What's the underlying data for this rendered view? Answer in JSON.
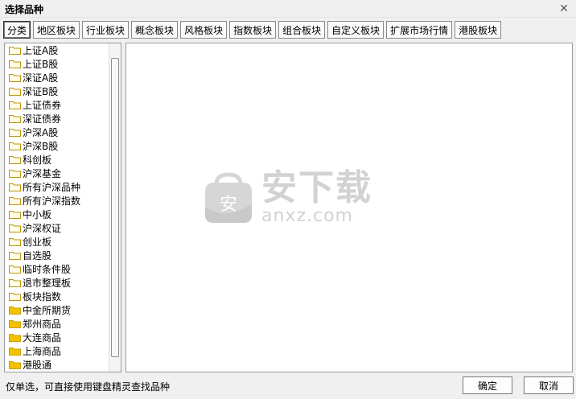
{
  "window": {
    "title": "选择品种"
  },
  "tabs": [
    {
      "label": "分类"
    },
    {
      "label": "地区板块"
    },
    {
      "label": "行业板块"
    },
    {
      "label": "概念板块"
    },
    {
      "label": "风格板块"
    },
    {
      "label": "指数板块"
    },
    {
      "label": "组合板块"
    },
    {
      "label": "自定义板块"
    },
    {
      "label": "扩展市场行情"
    },
    {
      "label": "港股板块"
    }
  ],
  "tree": [
    {
      "label": "上证A股"
    },
    {
      "label": "上证B股"
    },
    {
      "label": "深证A股"
    },
    {
      "label": "深证B股"
    },
    {
      "label": "上证债券"
    },
    {
      "label": "深证债券"
    },
    {
      "label": "沪深A股"
    },
    {
      "label": "沪深B股"
    },
    {
      "label": "科创板"
    },
    {
      "label": "沪深基金"
    },
    {
      "label": "所有沪深品种"
    },
    {
      "label": "所有沪深指数"
    },
    {
      "label": "中小板"
    },
    {
      "label": "沪深权证"
    },
    {
      "label": "创业板"
    },
    {
      "label": "自选股"
    },
    {
      "label": "临时条件股"
    },
    {
      "label": "退市整理板"
    },
    {
      "label": "板块指数"
    },
    {
      "label": "中金所期货"
    },
    {
      "label": "郑州商品"
    },
    {
      "label": "大连商品"
    },
    {
      "label": "上海商品"
    },
    {
      "label": "港股通"
    }
  ],
  "watermark": {
    "cn": "安下载",
    "en": "anxz.com",
    "logo_char": "安"
  },
  "status": {
    "text": "仅单选，可直接使用键盘精灵查找品种"
  },
  "buttons": {
    "ok": "确定",
    "cancel": "取消"
  },
  "colors": {
    "folder_closed": "#f5d76e",
    "folder_filled": "#f2c200",
    "watermark": "#d2d2d2"
  }
}
